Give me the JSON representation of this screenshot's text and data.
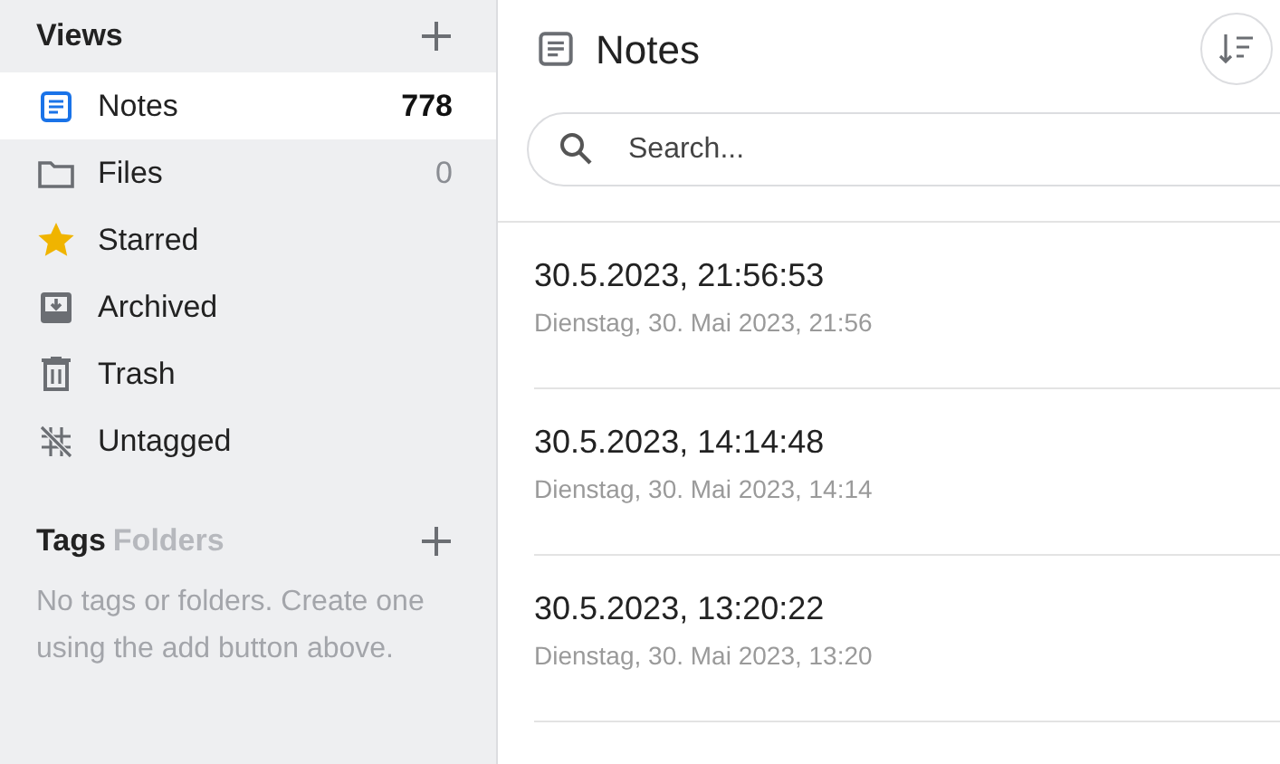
{
  "sidebar": {
    "views_title": "Views",
    "items": [
      {
        "label": "Notes",
        "count": "778",
        "selected": true
      },
      {
        "label": "Files",
        "count": "0",
        "selected": false
      },
      {
        "label": "Starred",
        "selected": false
      },
      {
        "label": "Archived",
        "selected": false
      },
      {
        "label": "Trash",
        "selected": false
      },
      {
        "label": "Untagged",
        "selected": false
      }
    ],
    "tabs": [
      {
        "label": "Tags",
        "selected": true
      },
      {
        "label": "Folders",
        "selected": false
      }
    ],
    "empty_message": "No tags or folders. Create one using the add button above."
  },
  "main": {
    "title": "Notes",
    "search": {
      "placeholder": "Search..."
    },
    "notes": [
      {
        "title": "30.5.2023, 21:56:53",
        "subtitle": "Dienstag, 30. Mai 2023, 21:56"
      },
      {
        "title": "30.5.2023, 14:14:48",
        "subtitle": "Dienstag, 30. Mai 2023, 14:14"
      },
      {
        "title": "30.5.2023, 13:20:22",
        "subtitle": "Dienstag, 30. Mai 2023, 13:20"
      }
    ]
  }
}
